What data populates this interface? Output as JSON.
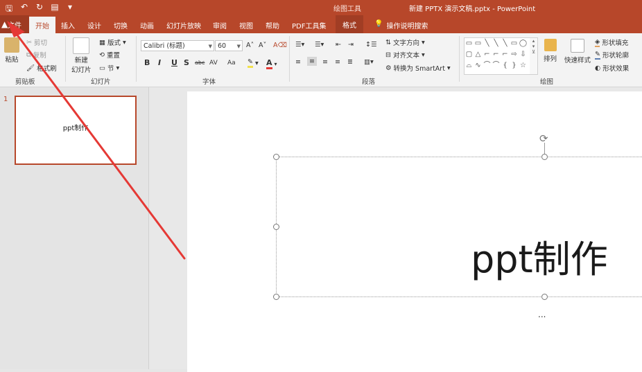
{
  "window": {
    "title": "新建 PPTX 演示文稿.pptx  -  PowerPoint",
    "contextual_label": "绘图工具",
    "quick_access": [
      "save-icon",
      "undo-icon",
      "redo-icon",
      "present-icon",
      "customize-icon"
    ]
  },
  "tabs": {
    "file": "文件",
    "home": "开始",
    "insert": "插入",
    "design": "设计",
    "transitions": "切换",
    "animations": "动画",
    "slideshow": "幻灯片放映",
    "review": "审阅",
    "view": "视图",
    "help": "帮助",
    "pdf": "PDF工具集",
    "format": "格式",
    "tell_me": "操作说明搜索"
  },
  "ribbon": {
    "clipboard": {
      "label": "剪贴板",
      "paste": "粘贴",
      "cut": "剪切",
      "copy": "复制",
      "format_painter": "格式刷"
    },
    "slides": {
      "label": "幻灯片",
      "new_slide": "新建\n幻灯片",
      "layout": "版式",
      "reset": "重置",
      "section": "节"
    },
    "font": {
      "label": "字体",
      "font_name": "Calibri (标题)",
      "font_size": "60",
      "bold": "B",
      "italic": "I",
      "underline": "U",
      "shadow": "S",
      "strike": "abc",
      "spacing": "AV",
      "case": "Aa",
      "color": "A"
    },
    "paragraph": {
      "label": "段落",
      "text_direction": "文字方向",
      "align_text": "对齐文本",
      "smartart": "转换为 SmartArt"
    },
    "drawing": {
      "label": "绘图",
      "arrange": "排列",
      "quick_styles": "快速样式",
      "shape_fill": "形状填充",
      "shape_outline": "形状轮廓",
      "shape_effects": "形状效果"
    }
  },
  "slides_panel": {
    "slide_number": "1",
    "thumb_text": "ppt制作"
  },
  "slide": {
    "title": "ppt制作",
    "ellipsis": "..."
  },
  "colors": {
    "accent": "#b7472a",
    "annotation_arrow": "#e53935"
  }
}
